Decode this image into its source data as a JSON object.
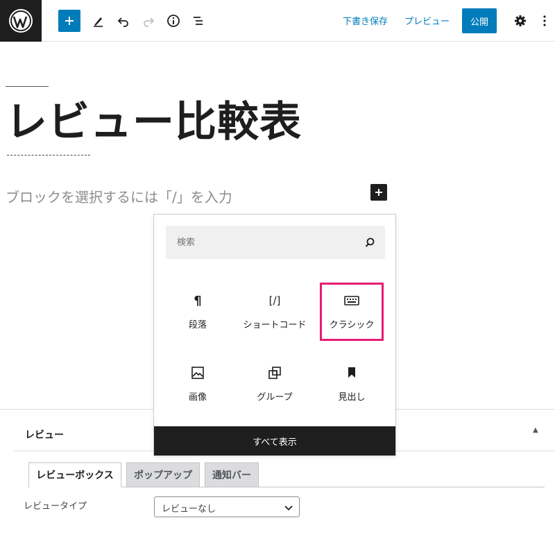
{
  "toolbar": {
    "save_draft": "下書き保存",
    "preview": "プレビュー",
    "publish": "公開"
  },
  "post": {
    "title": "レビュー比較表",
    "block_placeholder": "ブロックを選択するには「/」を入力"
  },
  "inserter": {
    "search_placeholder": "検索",
    "blocks": [
      {
        "label": "段落",
        "icon": "paragraph-icon"
      },
      {
        "label": "ショートコード",
        "icon": "shortcode-icon"
      },
      {
        "label": "クラシック",
        "icon": "keyboard-icon"
      },
      {
        "label": "画像",
        "icon": "image-icon"
      },
      {
        "label": "グループ",
        "icon": "group-icon"
      },
      {
        "label": "見出し",
        "icon": "bookmark-icon"
      }
    ],
    "shortcode_glyph": "[/]",
    "show_all": "すべて表示",
    "highlight_color": "#e61b74"
  },
  "metabox": {
    "title": "レビュー",
    "toggle": "▲",
    "tabs": [
      "レビューボックス",
      "ポップアップ",
      "通知バー"
    ],
    "field_label": "レビュータイプ",
    "select_value": "レビューなし"
  },
  "colors": {
    "accent": "#007cba",
    "dark": "#1e1e1e"
  }
}
